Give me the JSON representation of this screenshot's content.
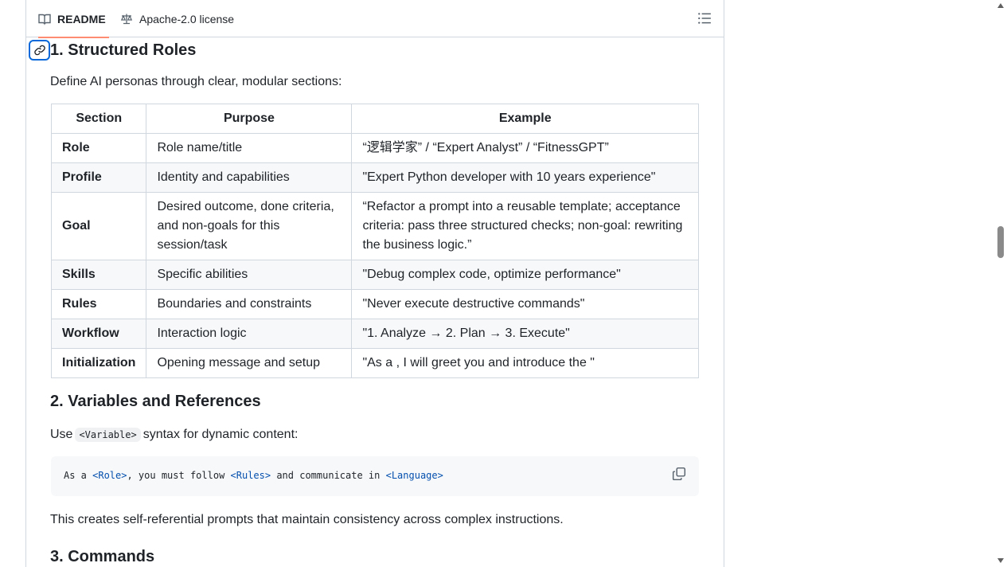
{
  "tabs": {
    "readme_label": "README",
    "license_label": "Apache-2.0 license"
  },
  "section1": {
    "title": "1. Structured Roles",
    "intro": "Define AI personas through clear, modular sections:",
    "table": {
      "headers": [
        "Section",
        "Purpose",
        "Example"
      ],
      "rows": [
        {
          "section": "Role",
          "purpose": "Role name/title",
          "example": "“逻辑学家” / “Expert Analyst” / “FitnessGPT”"
        },
        {
          "section": "Profile",
          "purpose": "Identity and capabilities",
          "example": "\"Expert Python developer with 10 years experience\""
        },
        {
          "section": "Goal",
          "purpose": "Desired outcome, done criteria, and non-goals for this session/task",
          "example": "“Refactor a prompt into a reusable template; acceptance criteria: pass three structured checks; non-goal: rewriting the business logic.”"
        },
        {
          "section": "Skills",
          "purpose": "Specific abilities",
          "example": "\"Debug complex code, optimize performance\""
        },
        {
          "section": "Rules",
          "purpose": "Boundaries and constraints",
          "example": "\"Never execute destructive commands\""
        },
        {
          "section": "Workflow",
          "purpose": "Interaction logic",
          "example": "\"1. Analyze → 2. Plan → 3. Execute\""
        },
        {
          "section": "Initialization",
          "purpose": "Opening message and setup",
          "example": "\"As a , I will greet you and introduce the \""
        }
      ]
    }
  },
  "section2": {
    "title": "2. Variables and References",
    "intro_before": "Use",
    "intro_code": "<Variable>",
    "intro_after": "syntax for dynamic content:",
    "code": {
      "t1": "As a ",
      "v1": "<Role>",
      "t2": ", you must follow ",
      "v2": "<Rules>",
      "t3": " and communicate in ",
      "v3": "<Language>"
    },
    "outro": "This creates self-referential prompts that maintain consistency across complex instructions."
  },
  "section3": {
    "title": "3. Commands"
  },
  "icons": {
    "readme": "book-icon",
    "license": "law-icon",
    "toc": "list-icon",
    "anchor": "link-icon",
    "copy": "copy-icon"
  },
  "colors": {
    "tab_underline": "#fd8c73",
    "link_blue": "#0969da",
    "code_var": "#0550ae",
    "border": "#d0d7de"
  }
}
